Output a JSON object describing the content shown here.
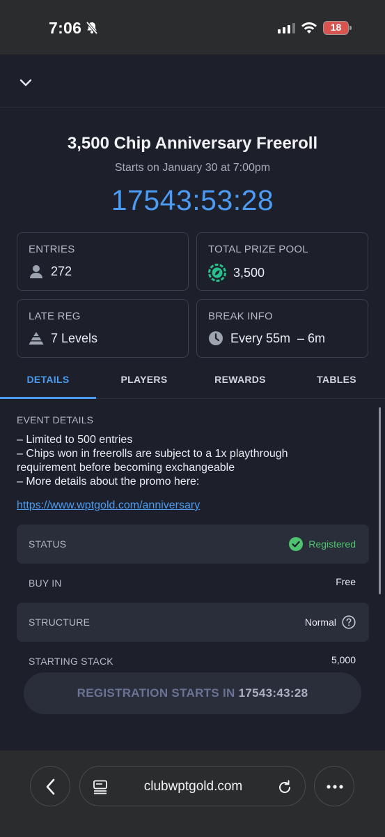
{
  "status_bar": {
    "time": "7:06",
    "battery": "18"
  },
  "event": {
    "title": "3,500 Chip Anniversary Freeroll",
    "subtitle": "Starts on January 30 at 7:00pm",
    "countdown": "17543:53:28"
  },
  "stats": {
    "entries": {
      "label": "ENTRIES",
      "value": "272"
    },
    "prize_pool": {
      "label": "TOTAL PRIZE POOL",
      "value": "3,500"
    },
    "late_reg": {
      "label": "LATE REG",
      "value": "7 Levels"
    },
    "break_info": {
      "label": "BREAK INFO",
      "value": "Every 55m  – 6m"
    }
  },
  "tabs": [
    {
      "label": "DETAILS",
      "active": true
    },
    {
      "label": "PLAYERS",
      "active": false
    },
    {
      "label": "REWARDS",
      "active": false
    },
    {
      "label": "TABLES",
      "active": false
    }
  ],
  "details": {
    "heading": "EVENT DETAILS",
    "lines": [
      "– Limited to 500 entries",
      "– Chips won in freerolls are subject to a 1x playthrough requirement before becoming exchangeable",
      "– More details about the promo here:"
    ],
    "link": "https://www.wptgold.com/anniversary"
  },
  "info_rows": {
    "status": {
      "label": "STATUS",
      "value": "Registered"
    },
    "buy_in": {
      "label": "BUY IN",
      "value": "Free"
    },
    "structure": {
      "label": "STRUCTURE",
      "value": "Normal"
    },
    "starting_stack": {
      "label": "STARTING STACK",
      "value": "5,000"
    }
  },
  "registration": {
    "label": "REGISTRATION STARTS IN",
    "time": "17543:43:28"
  },
  "browser": {
    "url": "clubwptgold.com"
  },
  "colors": {
    "accent": "#4c9bf2",
    "success": "#4fc36d",
    "prize": "#27c08a",
    "background": "#1d202b"
  },
  "icons": [
    "bell-slash-icon",
    "signal-icon",
    "wifi-icon",
    "battery-icon",
    "chevron-down-icon",
    "user-icon",
    "chip-icon",
    "pyramid-icon",
    "clock-icon",
    "check-circle-icon",
    "help-circle-icon",
    "chevron-left-icon",
    "tabs-icon",
    "reload-icon",
    "more-icon"
  ]
}
